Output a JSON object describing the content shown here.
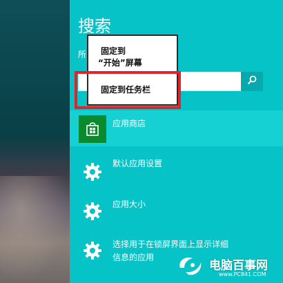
{
  "charm": {
    "title": "搜索",
    "scope_label": "所"
  },
  "search": {
    "value": "",
    "placeholder": ""
  },
  "context_menu": {
    "items": [
      {
        "line1": "固定到",
        "line2": "“开始”屏幕"
      },
      {
        "line1": "固定到任务栏"
      }
    ]
  },
  "results": [
    {
      "label": "应用商店",
      "icon": "store-icon",
      "selected": true
    },
    {
      "label": "默认应用设置",
      "icon": "gear-icon"
    },
    {
      "label": "应用大小",
      "icon": "gear-icon"
    },
    {
      "label_line1": "选择用于在锁屏界面上显示详细",
      "label_line2": "信息的应用",
      "icon": "gear-icon"
    }
  ],
  "watermark": {
    "brand": "电脑百事网",
    "url": "www.PC841.COM"
  },
  "colors": {
    "charm_bg": "#05c3c6",
    "selected_row": "#16d1d4",
    "store_tile": "#0a8a2f",
    "highlight_border": "#e0242b"
  }
}
